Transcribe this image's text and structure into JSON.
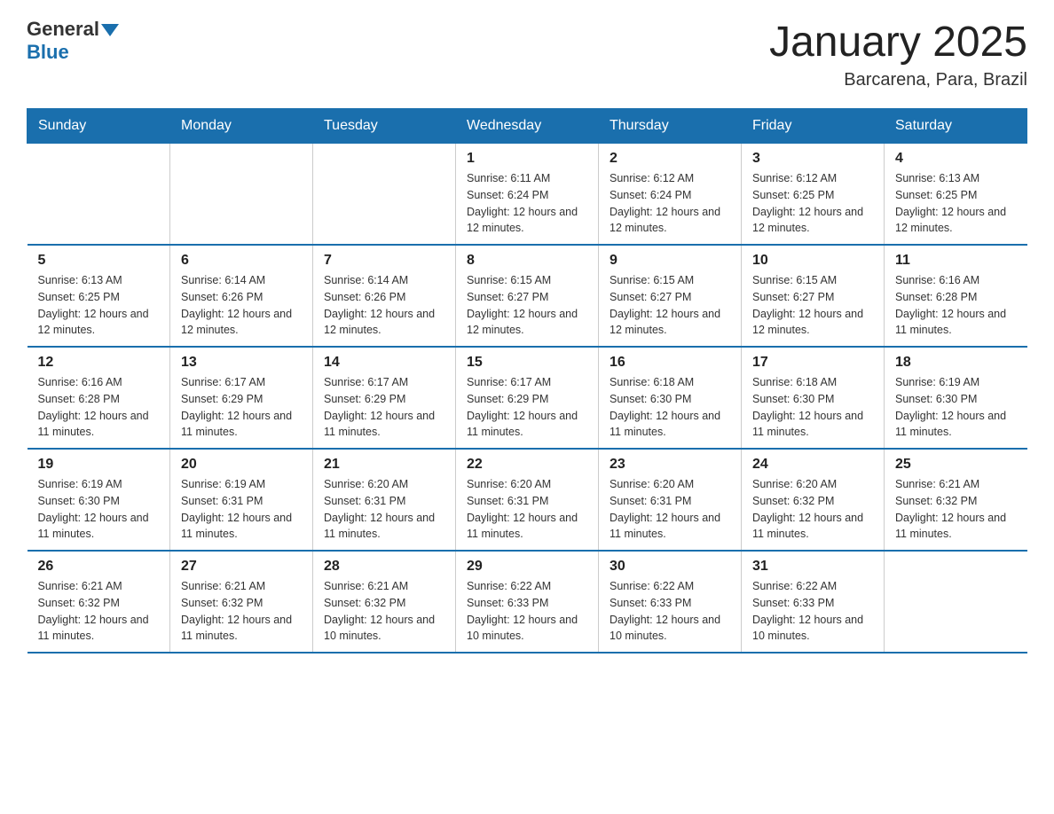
{
  "header": {
    "logo_general": "General",
    "logo_blue": "Blue",
    "title": "January 2025",
    "location": "Barcarena, Para, Brazil"
  },
  "days_of_week": [
    "Sunday",
    "Monday",
    "Tuesday",
    "Wednesday",
    "Thursday",
    "Friday",
    "Saturday"
  ],
  "weeks": [
    [
      {
        "day": "",
        "info": ""
      },
      {
        "day": "",
        "info": ""
      },
      {
        "day": "",
        "info": ""
      },
      {
        "day": "1",
        "info": "Sunrise: 6:11 AM\nSunset: 6:24 PM\nDaylight: 12 hours and 12 minutes."
      },
      {
        "day": "2",
        "info": "Sunrise: 6:12 AM\nSunset: 6:24 PM\nDaylight: 12 hours and 12 minutes."
      },
      {
        "day": "3",
        "info": "Sunrise: 6:12 AM\nSunset: 6:25 PM\nDaylight: 12 hours and 12 minutes."
      },
      {
        "day": "4",
        "info": "Sunrise: 6:13 AM\nSunset: 6:25 PM\nDaylight: 12 hours and 12 minutes."
      }
    ],
    [
      {
        "day": "5",
        "info": "Sunrise: 6:13 AM\nSunset: 6:25 PM\nDaylight: 12 hours and 12 minutes."
      },
      {
        "day": "6",
        "info": "Sunrise: 6:14 AM\nSunset: 6:26 PM\nDaylight: 12 hours and 12 minutes."
      },
      {
        "day": "7",
        "info": "Sunrise: 6:14 AM\nSunset: 6:26 PM\nDaylight: 12 hours and 12 minutes."
      },
      {
        "day": "8",
        "info": "Sunrise: 6:15 AM\nSunset: 6:27 PM\nDaylight: 12 hours and 12 minutes."
      },
      {
        "day": "9",
        "info": "Sunrise: 6:15 AM\nSunset: 6:27 PM\nDaylight: 12 hours and 12 minutes."
      },
      {
        "day": "10",
        "info": "Sunrise: 6:15 AM\nSunset: 6:27 PM\nDaylight: 12 hours and 12 minutes."
      },
      {
        "day": "11",
        "info": "Sunrise: 6:16 AM\nSunset: 6:28 PM\nDaylight: 12 hours and 11 minutes."
      }
    ],
    [
      {
        "day": "12",
        "info": "Sunrise: 6:16 AM\nSunset: 6:28 PM\nDaylight: 12 hours and 11 minutes."
      },
      {
        "day": "13",
        "info": "Sunrise: 6:17 AM\nSunset: 6:29 PM\nDaylight: 12 hours and 11 minutes."
      },
      {
        "day": "14",
        "info": "Sunrise: 6:17 AM\nSunset: 6:29 PM\nDaylight: 12 hours and 11 minutes."
      },
      {
        "day": "15",
        "info": "Sunrise: 6:17 AM\nSunset: 6:29 PM\nDaylight: 12 hours and 11 minutes."
      },
      {
        "day": "16",
        "info": "Sunrise: 6:18 AM\nSunset: 6:30 PM\nDaylight: 12 hours and 11 minutes."
      },
      {
        "day": "17",
        "info": "Sunrise: 6:18 AM\nSunset: 6:30 PM\nDaylight: 12 hours and 11 minutes."
      },
      {
        "day": "18",
        "info": "Sunrise: 6:19 AM\nSunset: 6:30 PM\nDaylight: 12 hours and 11 minutes."
      }
    ],
    [
      {
        "day": "19",
        "info": "Sunrise: 6:19 AM\nSunset: 6:30 PM\nDaylight: 12 hours and 11 minutes."
      },
      {
        "day": "20",
        "info": "Sunrise: 6:19 AM\nSunset: 6:31 PM\nDaylight: 12 hours and 11 minutes."
      },
      {
        "day": "21",
        "info": "Sunrise: 6:20 AM\nSunset: 6:31 PM\nDaylight: 12 hours and 11 minutes."
      },
      {
        "day": "22",
        "info": "Sunrise: 6:20 AM\nSunset: 6:31 PM\nDaylight: 12 hours and 11 minutes."
      },
      {
        "day": "23",
        "info": "Sunrise: 6:20 AM\nSunset: 6:31 PM\nDaylight: 12 hours and 11 minutes."
      },
      {
        "day": "24",
        "info": "Sunrise: 6:20 AM\nSunset: 6:32 PM\nDaylight: 12 hours and 11 minutes."
      },
      {
        "day": "25",
        "info": "Sunrise: 6:21 AM\nSunset: 6:32 PM\nDaylight: 12 hours and 11 minutes."
      }
    ],
    [
      {
        "day": "26",
        "info": "Sunrise: 6:21 AM\nSunset: 6:32 PM\nDaylight: 12 hours and 11 minutes."
      },
      {
        "day": "27",
        "info": "Sunrise: 6:21 AM\nSunset: 6:32 PM\nDaylight: 12 hours and 11 minutes."
      },
      {
        "day": "28",
        "info": "Sunrise: 6:21 AM\nSunset: 6:32 PM\nDaylight: 12 hours and 10 minutes."
      },
      {
        "day": "29",
        "info": "Sunrise: 6:22 AM\nSunset: 6:33 PM\nDaylight: 12 hours and 10 minutes."
      },
      {
        "day": "30",
        "info": "Sunrise: 6:22 AM\nSunset: 6:33 PM\nDaylight: 12 hours and 10 minutes."
      },
      {
        "day": "31",
        "info": "Sunrise: 6:22 AM\nSunset: 6:33 PM\nDaylight: 12 hours and 10 minutes."
      },
      {
        "day": "",
        "info": ""
      }
    ]
  ]
}
